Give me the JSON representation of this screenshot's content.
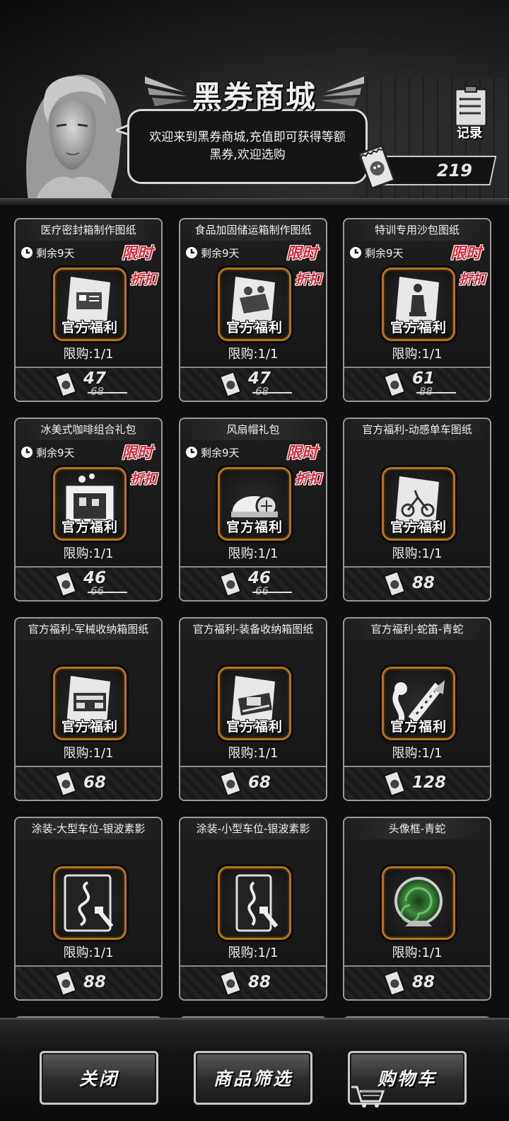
{
  "header": {
    "title": "黑券商城",
    "welcome": "欢迎来到黑券商城,充值即可获得等额黑券,欢迎选购",
    "record_label": "记录",
    "balance": "219"
  },
  "cards": [
    {
      "title": "医疗密封箱制作图纸",
      "timer": "剩余9天",
      "limited": "限时",
      "discount": "折扣",
      "tag": "官方福利",
      "limit": "限购:1/1",
      "price": "47",
      "old_price": "68"
    },
    {
      "title": "食品加固储运箱制作图纸",
      "timer": "剩余9天",
      "limited": "限时",
      "discount": "折扣",
      "tag": "官方福利",
      "limit": "限购:1/1",
      "price": "47",
      "old_price": "68"
    },
    {
      "title": "特训专用沙包图纸",
      "timer": "剩余9天",
      "limited": "限时",
      "discount": "折扣",
      "tag": "官方福利",
      "limit": "限购:1/1",
      "price": "61",
      "old_price": "88"
    },
    {
      "title": "冰美式咖啡组合礼包",
      "timer": "剩余9天",
      "limited": "限时",
      "discount": "折扣",
      "tag": "官方福利",
      "limit": "限购:1/1",
      "price": "46",
      "old_price": "66"
    },
    {
      "title": "风扇帽礼包",
      "timer": "剩余9天",
      "limited": "限时",
      "discount": "折扣",
      "tag": "官方福利",
      "limit": "限购:1/1",
      "price": "46",
      "old_price": "66"
    },
    {
      "title": "官方福利-动感单车图纸",
      "tag": "官方福利",
      "limit": "限购:1/1",
      "price": "88"
    },
    {
      "title": "官方福利-军械收纳箱图纸",
      "tag": "官方福利",
      "limit": "限购:1/1",
      "price": "68"
    },
    {
      "title": "官方福利-装备收纳箱图纸",
      "tag": "官方福利",
      "limit": "限购:1/1",
      "price": "68"
    },
    {
      "title": "官方福利-蛇笛-青蛇",
      "tag": "官方福利",
      "limit": "限购:1/1",
      "price": "128"
    },
    {
      "title": "涂装-大型车位-银波素影",
      "limit": "限购:1/1",
      "price": "88"
    },
    {
      "title": "涂装-小型车位-银波素影",
      "limit": "限购:1/1",
      "price": "88"
    },
    {
      "title": "头像框-青蛇",
      "limit": "限购:1/1",
      "price": "88"
    }
  ],
  "buttons": {
    "close": "关闭",
    "filter": "商品筛选",
    "cart": "购物车"
  },
  "icons": [
    "clipboard-icon",
    "ticket-icon",
    "clock-icon",
    "blueprint-icon",
    "cart-icon",
    "snake-icon",
    "avatar-frame-icon"
  ],
  "colors": {
    "accent_red": "#d8293a",
    "icon_border": "#b0761e"
  }
}
